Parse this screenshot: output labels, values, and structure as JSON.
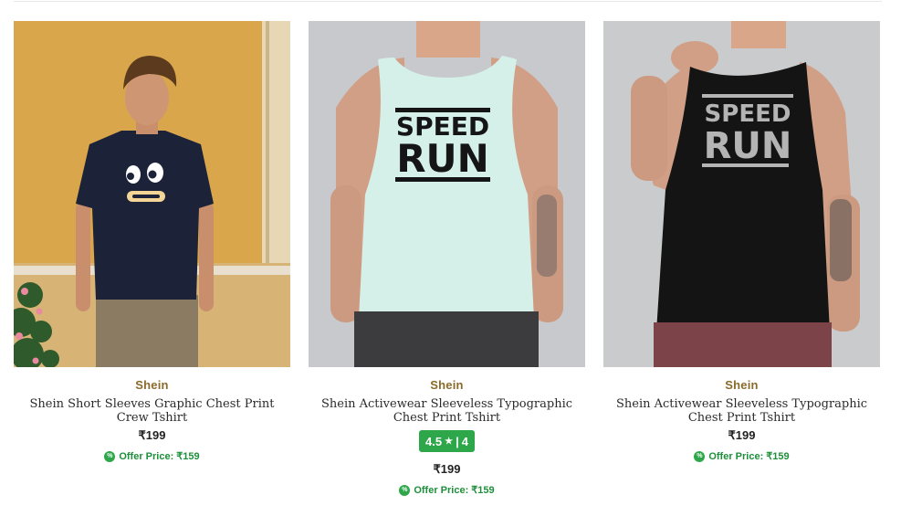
{
  "colors": {
    "brand": "#8a6a2b",
    "rating_bg": "#2da74a",
    "offer_text": "#1e8f3a"
  },
  "products": [
    {
      "brand": "Shein",
      "title": "Shein Short Sleeves Graphic Chest Print Crew Tshirt",
      "price": "₹199",
      "offer": "Offer Price: ₹159",
      "image": "man-navy-tshirt-face-graphic"
    },
    {
      "brand": "Shein",
      "title": "Shein Activewear Sleeveless Typographic Chest Print Tshirt",
      "rating": "4.5",
      "rating_count": "4",
      "price": "₹199",
      "offer": "Offer Price: ₹159",
      "image": "mint-tank-top-speed-run",
      "graphic_text": [
        "SPEED",
        "RUN"
      ]
    },
    {
      "brand": "Shein",
      "title": "Shein Activewear Sleeveless Typographic Chest Print Tshirt",
      "price": "₹199",
      "offer": "Offer Price: ₹159",
      "image": "black-tank-top-speed-run",
      "graphic_text": [
        "SPEED",
        "RUN"
      ]
    }
  ]
}
